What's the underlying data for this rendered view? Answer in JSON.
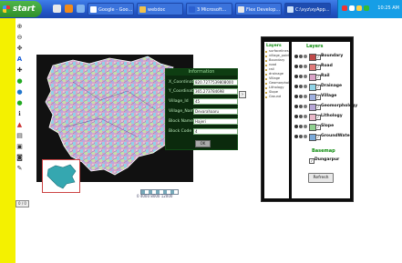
{
  "taskbar": {
    "start_label": "start",
    "tasks": [
      {
        "label": "Google - Goo..."
      },
      {
        "label": "webdoc"
      },
      {
        "label": "3 Microsoft..."
      },
      {
        "label": "Flex Develop..."
      },
      {
        "label": "C:\\xyz\\xyApp..."
      }
    ],
    "clock": "10:25 AM"
  },
  "info_panel": {
    "title": "Information",
    "fields": [
      {
        "label": "X_Coordinate",
        "value": "820.7277539808000"
      },
      {
        "label": "Y_Coordinate",
        "value": "365.273784698"
      },
      {
        "label": "Village_Id",
        "value": "45"
      },
      {
        "label": "Village_Name",
        "value": "Devarahaaru"
      },
      {
        "label": "Block Name",
        "value": "Hajeri"
      },
      {
        "label": "Block Code",
        "value": "4"
      }
    ],
    "ok_label": "OK"
  },
  "layers_tree": {
    "title": "Layers",
    "items": [
      "surfacelines",
      "village_point",
      "Boundary",
      "road",
      "rail",
      "drainage",
      "Village",
      "Geomorphology",
      "Lithology",
      "Slope",
      "Ground"
    ]
  },
  "legend": {
    "title": "Layers",
    "rows": [
      {
        "name": "Boundary",
        "checked": "✓",
        "color": "#c04a4a"
      },
      {
        "name": "Road",
        "checked": "✓",
        "color": "#e07a7a"
      },
      {
        "name": "Rail",
        "checked": "✓",
        "color": "#d9a2c6"
      },
      {
        "name": "Drainage",
        "checked": "✓",
        "color": "#8fd3e6"
      },
      {
        "name": "Village",
        "checked": "✓",
        "color": "#9fb0e0"
      },
      {
        "name": "Geomorphology",
        "checked": "✓",
        "color": "#b7a6d6"
      },
      {
        "name": "Lithology",
        "checked": "✓",
        "color": "#e8b7c8"
      },
      {
        "name": "Slope",
        "checked": "✓",
        "color": "#8fd08f"
      },
      {
        "name": "GroundWater",
        "checked": "✓",
        "color": "#7aa9d9"
      }
    ],
    "basemap_title": "Basemap",
    "basemap_item": {
      "name": "Dungarpur",
      "checked": "✓"
    },
    "refresh_label": "Refresh"
  },
  "map": {
    "scale_label": "0  4000  8000  12000"
  },
  "bottom_left_button": "0 / 0"
}
